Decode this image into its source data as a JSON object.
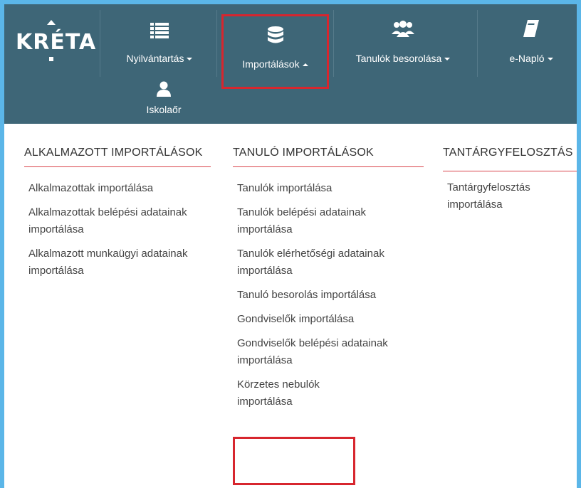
{
  "brand": {
    "logo_text": "KRÉTA"
  },
  "navbar": {
    "items": [
      {
        "label": "Nyilvántartás",
        "icon": "list-icon",
        "caret": "down"
      },
      {
        "label": "Importálások",
        "icon": "database-icon",
        "caret": "up",
        "active": true
      },
      {
        "label": "Tanulók besorolása",
        "icon": "users-icon",
        "caret": "down"
      },
      {
        "label": "e-Napló",
        "icon": "book-icon",
        "caret": "down"
      },
      {
        "label": "Iskolaőr",
        "icon": "user-icon"
      }
    ],
    "bg_color": "#3e6677",
    "highlight_color": "#d7262e"
  },
  "menu": {
    "columns": [
      {
        "heading": "ALKALMAZOTT IMPORTÁLÁSOK",
        "items": [
          "Alkalmazottak importálása",
          "Alkalmazottak belépési adatainak importálása",
          "Alkalmazott munkaügyi adatainak importálása"
        ]
      },
      {
        "heading": "TANULÓ IMPORTÁLÁSOK",
        "items": [
          "Tanulók importálása",
          "Tanulók belépési adatainak importálása",
          "Tanulók elérhetőségi adatainak importálása",
          "Tanuló besorolás importálása",
          "Gondviselők importálása",
          "Gondviselők belépési adatainak importálása",
          "Körzetes nebulók importálása"
        ]
      },
      {
        "heading": "TANTÁRGYFELOSZTÁS",
        "items": [
          "Tantárgyfelosztás importálása"
        ]
      }
    ]
  }
}
